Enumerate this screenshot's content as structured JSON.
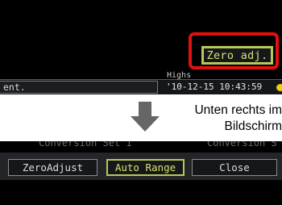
{
  "top_screen": {
    "zero_adj_button": "Zero adj.",
    "highs_label": "Highs",
    "status_left_text": "ent.",
    "status_time": "'10-12-15 10:43:59"
  },
  "caption": {
    "line1": "Unten rechts im",
    "line2": "Bildschirm"
  },
  "bottom_screen": {
    "conversion_left": "Conversion Set 1",
    "conversion_right": "Conversion S",
    "buttons": {
      "zero_adjust": "ZeroAdjust",
      "auto_range": "Auto Range",
      "close": "Close"
    }
  },
  "colors": {
    "highlight_red": "#e01010",
    "selected_border": "#b5c95a",
    "selected_text": "#d8e070",
    "status_dot": "#f0d000",
    "arrow_gray": "#666666"
  }
}
